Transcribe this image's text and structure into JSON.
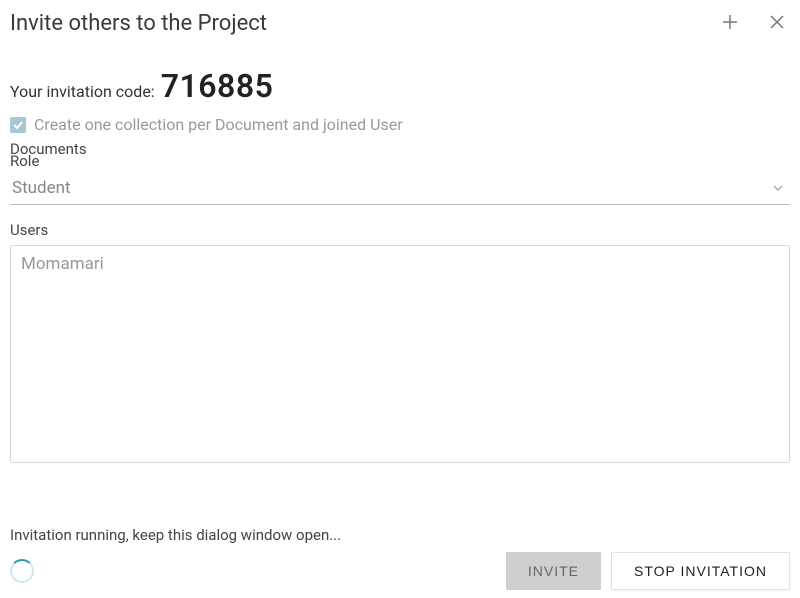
{
  "header": {
    "title": "Invite others to the Project"
  },
  "invitation": {
    "label": "Your invitation code:",
    "code": "716885"
  },
  "checkbox": {
    "label": "Create one collection per Document and joined User",
    "checked": true
  },
  "documents_label": "Documents",
  "role": {
    "label": "Role",
    "value": "Student"
  },
  "users": {
    "label": "Users",
    "items": [
      "Momamari"
    ]
  },
  "status": {
    "text": "Invitation running, keep this dialog window open..."
  },
  "buttons": {
    "invite": "INVITE",
    "stop": "STOP INVITATION"
  }
}
